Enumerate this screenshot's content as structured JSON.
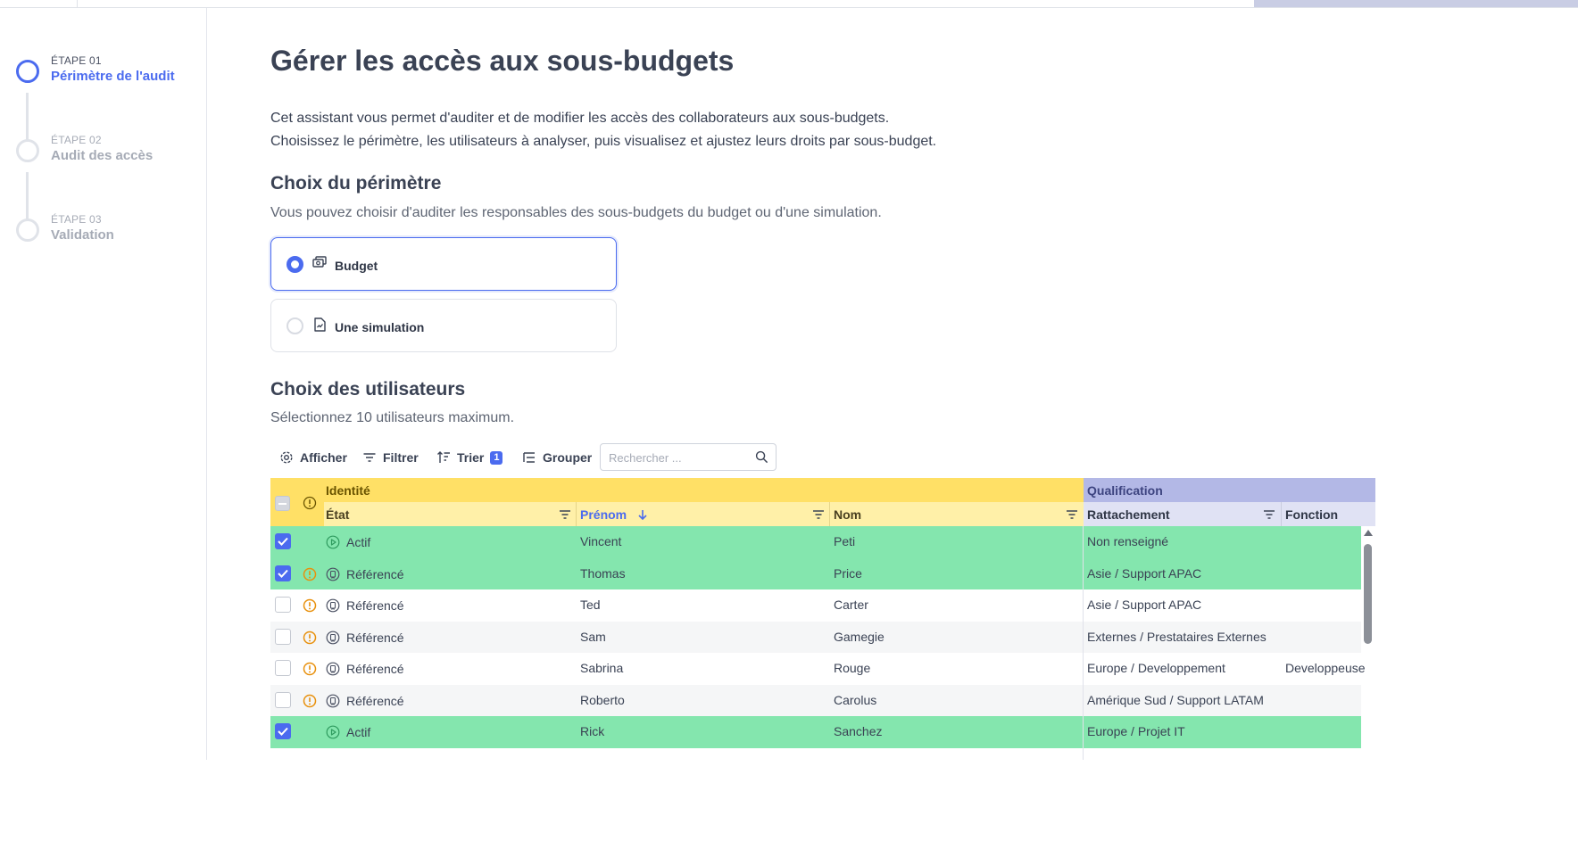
{
  "stepper": {
    "steps": [
      {
        "number": "ÉTAPE 01",
        "label": "Périmètre de l'audit",
        "active": true
      },
      {
        "number": "ÉTAPE 02",
        "label": "Audit des accès",
        "active": false
      },
      {
        "number": "ÉTAPE 03",
        "label": "Validation",
        "active": false
      }
    ]
  },
  "page": {
    "title": "Gérer les accès aux sous-budgets",
    "intro_line1": "Cet assistant vous permet d'auditer et de modifier les accès des collaborateurs aux sous-budgets.",
    "intro_line2": "Choisissez le périmètre, les utilisateurs à analyser, puis visualisez et ajustez leurs droits par sous-budget."
  },
  "perimeter": {
    "title": "Choix du périmètre",
    "subtitle": "Vous pouvez choisir d'auditer les responsables des sous-budgets du budget ou d'une simulation.",
    "options": [
      {
        "label": "Budget",
        "icon": "money-icon",
        "selected": true
      },
      {
        "label": "Une simulation",
        "icon": "document-chart-icon",
        "selected": false
      }
    ]
  },
  "users": {
    "title": "Choix des utilisateurs",
    "subtitle": "Sélectionnez 10 utilisateurs maximum."
  },
  "toolbar": {
    "show_label": "Afficher",
    "filter_label": "Filtrer",
    "sort_label": "Trier",
    "sort_count": "1",
    "group_label": "Grouper",
    "search_placeholder": "Rechercher ..."
  },
  "grid": {
    "group_identity": "Identité",
    "group_qualification": "Qualification",
    "columns": {
      "etat": "État",
      "prenom": "Prénom",
      "nom": "Nom",
      "rattachement": "Rattachement",
      "fonction": "Fonction"
    },
    "rows": [
      {
        "selected": true,
        "warning": false,
        "state_icon": "play-icon",
        "etat": "Actif",
        "prenom": "Vincent",
        "nom": "Peti",
        "rattachement": "Non renseigné",
        "fonction": ""
      },
      {
        "selected": true,
        "warning": true,
        "state_icon": "badge-icon",
        "etat": "Référencé",
        "prenom": "Thomas",
        "nom": "Price",
        "rattachement": "Asie / Support APAC",
        "fonction": ""
      },
      {
        "selected": false,
        "warning": true,
        "state_icon": "badge-icon",
        "etat": "Référencé",
        "prenom": "Ted",
        "nom": "Carter",
        "rattachement": "Asie / Support APAC",
        "fonction": ""
      },
      {
        "selected": false,
        "warning": true,
        "state_icon": "badge-icon",
        "etat": "Référencé",
        "prenom": "Sam",
        "nom": "Gamegie",
        "rattachement": "Externes / Prestataires Externes",
        "fonction": ""
      },
      {
        "selected": false,
        "warning": true,
        "state_icon": "badge-icon",
        "etat": "Référencé",
        "prenom": "Sabrina",
        "nom": "Rouge",
        "rattachement": "Europe / Developpement",
        "fonction": "Developpeuse"
      },
      {
        "selected": false,
        "warning": true,
        "state_icon": "badge-icon",
        "etat": "Référencé",
        "prenom": "Roberto",
        "nom": "Carolus",
        "rattachement": "Amérique Sud / Support LATAM",
        "fonction": ""
      },
      {
        "selected": true,
        "warning": false,
        "state_icon": "play-icon",
        "etat": "Actif",
        "prenom": "Rick",
        "nom": "Sanchez",
        "rattachement": "Europe / Projet IT",
        "fonction": ""
      }
    ]
  },
  "colors": {
    "accent": "#4b6bef",
    "identity_group": "#ffe066",
    "qualification_group": "#b3b8e6",
    "row_selected": "#84e6ae",
    "warning": "#e8900c"
  }
}
